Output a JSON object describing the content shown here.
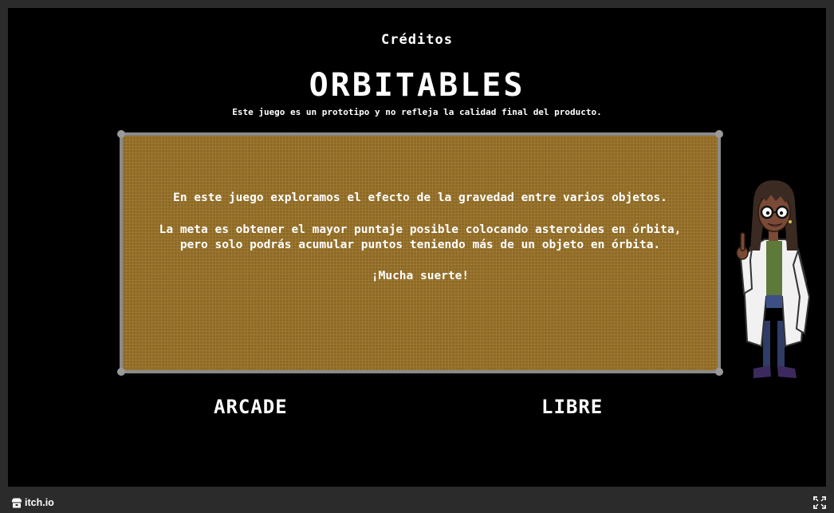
{
  "game": {
    "credits_label": "Créditos",
    "title": "ORBITABLES",
    "disclaimer": "Este juego es un prototipo y no refleja la calidad final del producto.",
    "panel": {
      "line1": "En este juego exploramos el efecto de la gravedad entre varios objetos.",
      "line2": "La meta es obtener el mayor puntaje posible colocando asteroides en órbita,",
      "line3": "pero solo podrás acumular puntos teniendo más de un objeto en órbita.",
      "line4": "¡Mucha suerte!"
    },
    "modes": {
      "arcade": "ARCADE",
      "libre": "LIBRE"
    }
  },
  "footer": {
    "brand": "itch.io"
  },
  "colors": {
    "panel_bg": "#8e6a27",
    "panel_border": "#8a8a8a",
    "frame_bg": "#000000",
    "bar_bg": "#2b2b2b"
  },
  "icons": [
    "itch-logo-icon",
    "fullscreen-icon"
  ]
}
